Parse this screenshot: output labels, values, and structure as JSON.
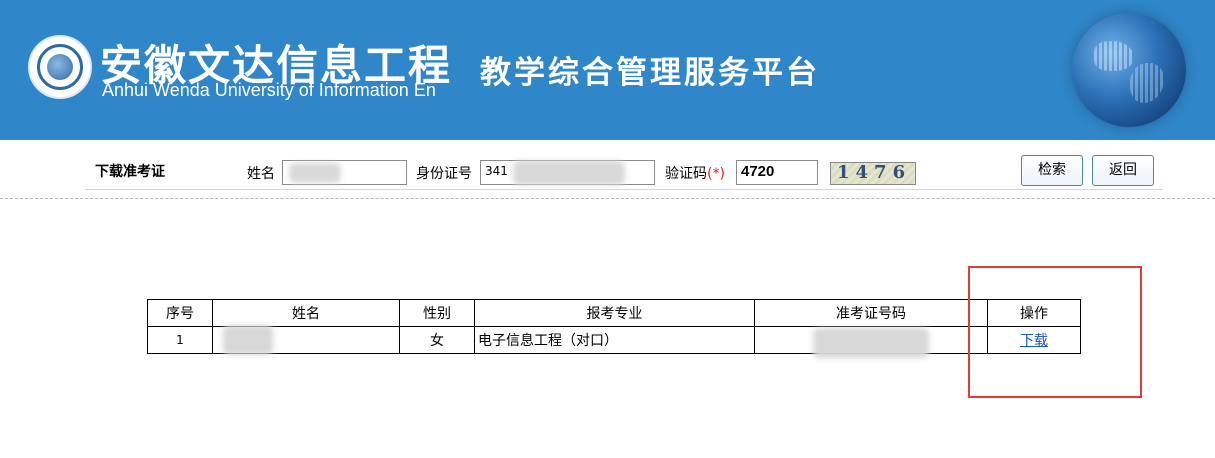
{
  "banner": {
    "school_name_cn": "安徽文达信息工程",
    "school_name_en": "Anhui Wenda University of Information En",
    "platform_title": "教学综合管理服务平台"
  },
  "search": {
    "section_title": "下载准考证",
    "name_label": "姓名",
    "name_value": "",
    "id_label": "身份证号",
    "id_value": "341",
    "captcha_label": "验证码",
    "captcha_required_mark": "(*)",
    "captcha_input_value": "4720",
    "captcha_image_text": "1476",
    "search_button": "检索",
    "back_button": "返回"
  },
  "table": {
    "headers": [
      "序号",
      "姓名",
      "性别",
      "报考专业",
      "准考证号码",
      "操作"
    ],
    "rows": [
      {
        "index": "1",
        "name": "",
        "gender": "女",
        "major": "电子信息工程（对口）",
        "ticket_number": "",
        "action": "下载"
      }
    ]
  },
  "colors": {
    "banner_bg": "#2f86c9",
    "highlight_border": "#e33b3b",
    "link": "#1a55c8"
  },
  "icons": {
    "logo": "university-seal-icon",
    "globe": "globe-icon"
  }
}
